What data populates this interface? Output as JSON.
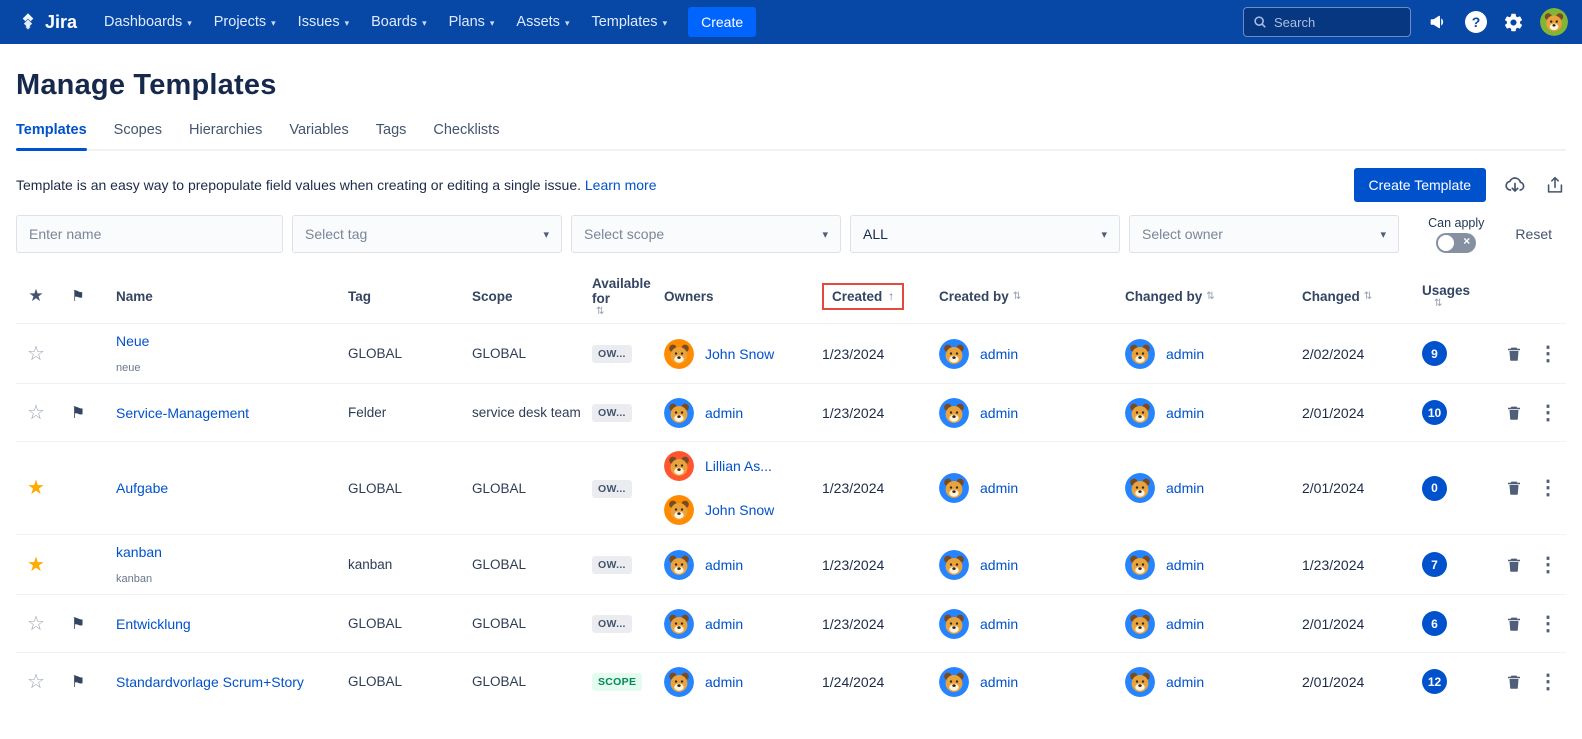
{
  "colors": {
    "nav_bg": "#0747A6",
    "accent": "#0052CC",
    "create_button": "#0065FF",
    "link": "#0052CC",
    "usage_badge": "#0052CC",
    "scope_badge_text": "#00875A",
    "star_active": "#FFAB00",
    "highlight_box": "#E5493A"
  },
  "nav": {
    "brand": "Jira",
    "items": [
      {
        "label": "Dashboards"
      },
      {
        "label": "Projects"
      },
      {
        "label": "Issues"
      },
      {
        "label": "Boards"
      },
      {
        "label": "Plans"
      },
      {
        "label": "Assets"
      },
      {
        "label": "Templates"
      }
    ],
    "create_label": "Create",
    "search_placeholder": "Search",
    "icons": [
      "search-icon",
      "announcement-icon",
      "help-icon",
      "settings-icon",
      "user-avatar"
    ],
    "avatar_color": "#82B536"
  },
  "page": {
    "title": "Manage Templates",
    "tabs": [
      {
        "label": "Templates",
        "active": true
      },
      {
        "label": "Scopes",
        "active": false
      },
      {
        "label": "Hierarchies",
        "active": false
      },
      {
        "label": "Variables",
        "active": false
      },
      {
        "label": "Tags",
        "active": false
      },
      {
        "label": "Checklists",
        "active": false
      }
    ],
    "description": "Template is an easy way to prepopulate field values when creating or editing a single issue.",
    "learn_more_label": "Learn more",
    "create_template_label": "Create Template",
    "toolbar_icons": [
      "cloud-download-icon",
      "export-icon"
    ]
  },
  "filters": {
    "name_placeholder": "Enter name",
    "tag_placeholder": "Select tag",
    "scope_placeholder": "Select scope",
    "category_value": "ALL",
    "owner_placeholder": "Select owner",
    "can_apply_label": "Can apply",
    "reset_label": "Reset"
  },
  "table": {
    "headers": {
      "name": "Name",
      "tag": "Tag",
      "scope": "Scope",
      "available_for": "Available for",
      "owners": "Owners",
      "created": "Created",
      "created_by": "Created by",
      "changed_by": "Changed by",
      "changed": "Changed",
      "usages": "Usages"
    },
    "sort": {
      "column": "Created",
      "direction": "asc"
    },
    "action_icons": [
      "trash-icon",
      "more-icon"
    ],
    "rows": [
      {
        "starred": false,
        "flagged": false,
        "name": "Neue",
        "subtitle": "neue",
        "tag": "GLOBAL",
        "scope": "GLOBAL",
        "available_for": "OW...",
        "available_type": "owner",
        "owners": [
          {
            "name": "John Snow",
            "color": "#FF8B00"
          }
        ],
        "created": "1/23/2024",
        "created_by": {
          "name": "admin",
          "color": "#2684FF"
        },
        "changed_by": {
          "name": "admin",
          "color": "#2684FF"
        },
        "changed": "2/02/2024",
        "usages": 9
      },
      {
        "starred": false,
        "flagged": true,
        "name": "Service-Management",
        "tag": "Felder",
        "scope": "service desk team",
        "available_for": "OW...",
        "available_type": "owner",
        "owners": [
          {
            "name": "admin",
            "color": "#2684FF"
          }
        ],
        "created": "1/23/2024",
        "created_by": {
          "name": "admin",
          "color": "#2684FF"
        },
        "changed_by": {
          "name": "admin",
          "color": "#2684FF"
        },
        "changed": "2/01/2024",
        "usages": 10
      },
      {
        "starred": true,
        "flagged": false,
        "name": "Aufgabe",
        "tag": "GLOBAL",
        "scope": "GLOBAL",
        "available_for": "OW...",
        "available_type": "owner",
        "owners": [
          {
            "name": "Lillian As...",
            "color": "#FF5630"
          },
          {
            "name": "John Snow",
            "color": "#FF8B00"
          }
        ],
        "created": "1/23/2024",
        "created_by": {
          "name": "admin",
          "color": "#2684FF"
        },
        "changed_by": {
          "name": "admin",
          "color": "#2684FF"
        },
        "changed": "2/01/2024",
        "usages": 0
      },
      {
        "starred": true,
        "flagged": false,
        "name": "kanban",
        "subtitle": "kanban",
        "tag": "kanban",
        "scope": "GLOBAL",
        "available_for": "OW...",
        "available_type": "owner",
        "owners": [
          {
            "name": "admin",
            "color": "#2684FF"
          }
        ],
        "created": "1/23/2024",
        "created_by": {
          "name": "admin",
          "color": "#2684FF"
        },
        "changed_by": {
          "name": "admin",
          "color": "#2684FF"
        },
        "changed": "1/23/2024",
        "usages": 7
      },
      {
        "starred": false,
        "flagged": true,
        "name": "Entwicklung",
        "tag": "GLOBAL",
        "scope": "GLOBAL",
        "available_for": "OW...",
        "available_type": "owner",
        "owners": [
          {
            "name": "admin",
            "color": "#2684FF"
          }
        ],
        "created": "1/23/2024",
        "created_by": {
          "name": "admin",
          "color": "#2684FF"
        },
        "changed_by": {
          "name": "admin",
          "color": "#2684FF"
        },
        "changed": "2/01/2024",
        "usages": 6
      },
      {
        "starred": false,
        "flagged": true,
        "name": "Standardvorlage Scrum+Story",
        "tag": "GLOBAL",
        "scope": "GLOBAL",
        "available_for": "SCOPE",
        "available_type": "scope",
        "owners": [
          {
            "name": "admin",
            "color": "#2684FF"
          }
        ],
        "created": "1/24/2024",
        "created_by": {
          "name": "admin",
          "color": "#2684FF"
        },
        "changed_by": {
          "name": "admin",
          "color": "#2684FF"
        },
        "changed": "2/01/2024",
        "usages": 12
      }
    ]
  }
}
